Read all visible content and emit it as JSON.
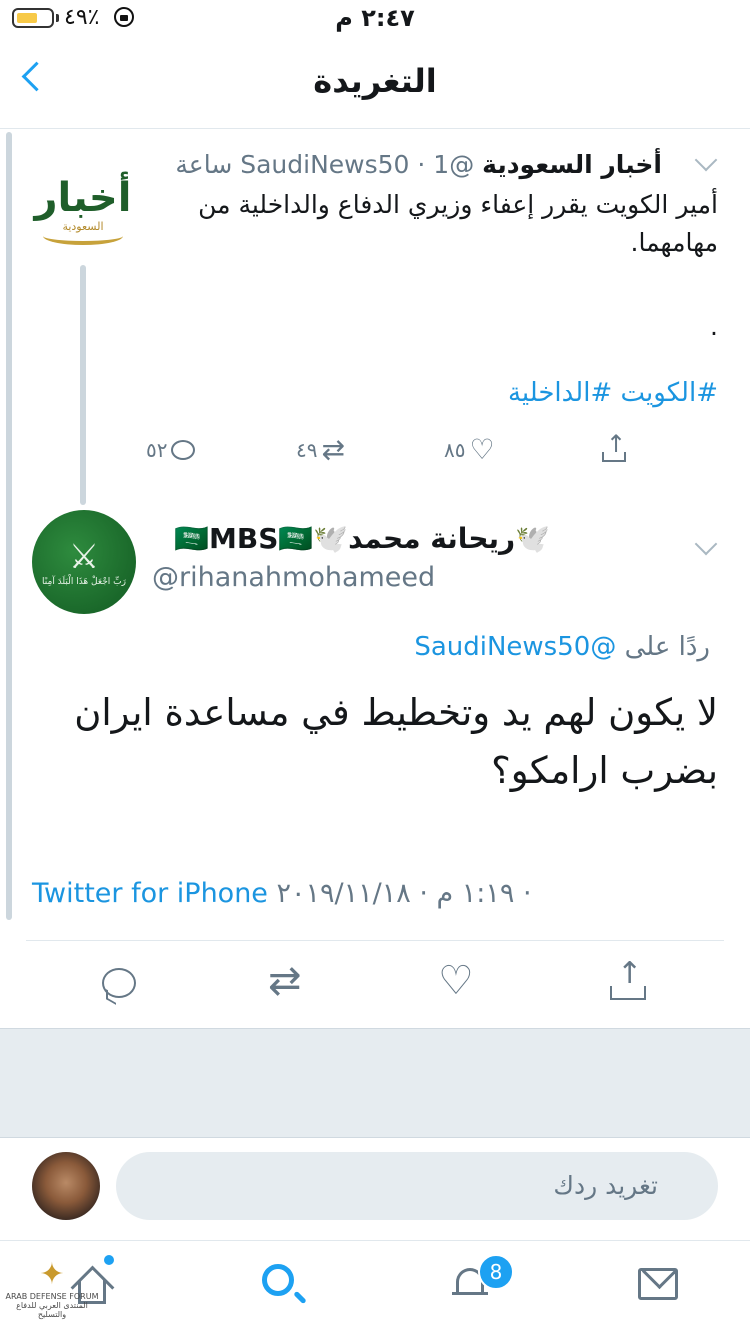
{
  "status_bar": {
    "battery_percent": "٤٩٪",
    "time": "٢:٤٧ م"
  },
  "nav": {
    "title": "التغريدة"
  },
  "tweet1": {
    "avatar_text": "أخبار",
    "avatar_subtext": "السعودية",
    "name": "أخبار السعودية",
    "handle": "@SaudiNews50",
    "time": "· 1 ساعة",
    "body": "أمير الكويت يقرر إعفاء وزيري الدفاع والداخلية من مهامهما.",
    "dot": ".",
    "hashtags": "#الكويت #الداخلية",
    "replies": "٥٢",
    "retweets": "٤٩",
    "likes": "٨٥"
  },
  "tweet2": {
    "avatar_emblem": "⚔",
    "avatar_text": "رَبِّ اجْعَلْ هَذَا الْبَلَدَ آمِنًا",
    "name": "🕊️ريحانة محمد🕊️🇸🇦MBS🇸🇦",
    "handle": "@rihanahmohameed",
    "reply_prefix": "ردًا على",
    "reply_to": "@SaudiNews50",
    "body": "لا يكون لهم يد وتخطيط في مساعدة ايران بضرب ارامكو؟",
    "meta": "١:١٩ م · ٢٠١٩/١١/١٨ · ",
    "source": "Twitter for iPhone"
  },
  "reply_bar": {
    "placeholder": "تغريد ردك"
  },
  "tab_bar": {
    "notifications_badge": "8"
  },
  "watermark": {
    "glyph": "✦",
    "line1": "ARAB DEFENSE FORUM",
    "line2": "المنتدى العربي للدفاع والتسليح"
  },
  "colors": {
    "accent": "#1da1f2",
    "link": "#1b95e0",
    "muted": "#657786",
    "separator": "#e1e8ed"
  }
}
